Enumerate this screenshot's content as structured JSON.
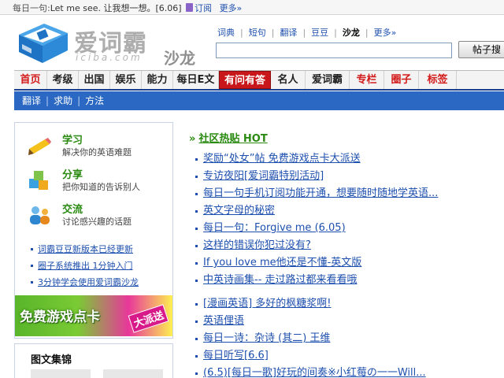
{
  "topbar": {
    "tip": "每日一句:",
    "message": "Let me see. 让我想一想。",
    "date": "[6.06]",
    "subscribe": "订阅",
    "more": "更多»"
  },
  "logo": {
    "brand": "爱词霸",
    "domain": "iciba.com",
    "section": "沙龙"
  },
  "topnav": [
    "词典",
    "短句",
    "翻译",
    "豆豆",
    "沙龙",
    "更多»"
  ],
  "search": {
    "value": "",
    "placeholder": "",
    "button_label": "帖子搜"
  },
  "mainnav": [
    {
      "label": "首页",
      "style": "red"
    },
    {
      "label": "考级",
      "style": "dark"
    },
    {
      "label": "出国",
      "style": "dark"
    },
    {
      "label": "娱乐",
      "style": "dark"
    },
    {
      "label": "能力",
      "style": "dark"
    },
    {
      "label": "每日E文",
      "style": "dark"
    },
    {
      "label": "有问有答",
      "style": "active"
    },
    {
      "label": "名人",
      "style": "dark"
    },
    {
      "label": "爱词霸",
      "style": "dark"
    },
    {
      "label": "专栏",
      "style": "red"
    },
    {
      "label": "圈子",
      "style": "red"
    },
    {
      "label": "标签",
      "style": "red"
    }
  ],
  "subnav": [
    "翻译",
    "求助",
    "方法"
  ],
  "features": [
    {
      "title": "学习",
      "desc": "解决你的英语难题",
      "icon": "pencil-icon"
    },
    {
      "title": "分享",
      "desc": "把你知道的告诉别人",
      "icon": "blocks-icon"
    },
    {
      "title": "交流",
      "desc": "讨论感兴趣的话题",
      "icon": "people-icon"
    }
  ],
  "left_links": [
    "词霸豆豆新版本已经更新",
    "圈子系统推出 1分钟入门",
    "3分钟学会使用爱词霸沙龙"
  ],
  "banner": {
    "text": "免费游戏点卡",
    "badge": "大派送"
  },
  "gallery": {
    "title": "图文集锦"
  },
  "hot": {
    "arrow": "»",
    "title": "社区热贴 HOT"
  },
  "posts": [
    "奖励“处女”帖 免费游戏点卡大派送",
    "专访夜阳[爱词霸特别活动]",
    "每日一句手机订阅功能开通，想要随时随地学英语...",
    "英文字母的秘密",
    "每日一句：Forgive me (6.05)",
    "这样的错误你犯过没有?",
    "If you love me他还是不懂-英文版",
    "中英诗画集-- 走过路过都来看看哦"
  ],
  "posts2": [
    "[漫画英语] 多好的枫糖浆啊!",
    "英语俚语",
    "每日一诗：杂诗 (其二) 王维",
    "每日听写[6.6]",
    "(6.5)[每日一歌]好玩的间奏※小红莓の一一Will..."
  ],
  "colors": {
    "nav_accent": "#1a3f8c",
    "subnav_bg": "#2a68c4",
    "active_tab": "#c9161b",
    "link": "#1d4fae",
    "green": "#2a8a11"
  }
}
